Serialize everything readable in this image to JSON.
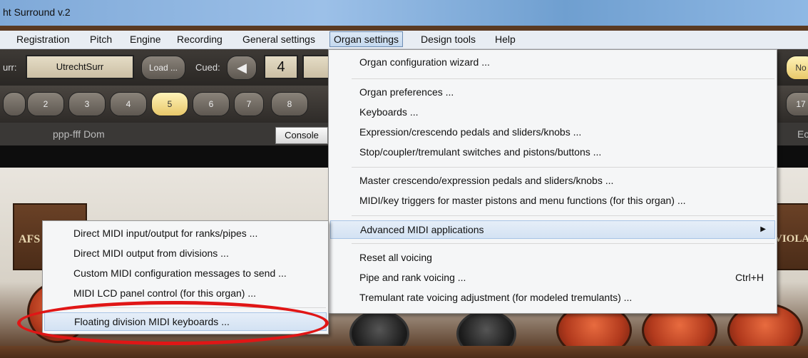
{
  "window": {
    "title": "ht Surround v.2"
  },
  "menubar": {
    "items": [
      "Registration",
      "Pitch",
      "Engine",
      "Recording",
      "General settings",
      "Organ settings",
      "Design tools",
      "Help"
    ],
    "active": "Organ settings"
  },
  "toolbar": {
    "surr_label": "urr:",
    "surr_value": "UtrechtSurr",
    "load_button": "Load ...",
    "cued_label": "Cued:",
    "cued_value": "4",
    "right_pill": "No",
    "piston_numbers": [
      "2",
      "3",
      "4",
      "5",
      "6",
      "7",
      "8"
    ],
    "piston_lit": "5",
    "right_piston": "17",
    "division_label": "ppp-fff Dom",
    "console_button": "Console",
    "right_edge_label": "Ec"
  },
  "organ": {
    "left_plaque": "AFS",
    "right_plaque": "VIOLA"
  },
  "organ_menu": {
    "items": [
      {
        "label": "Organ configuration wizard ..."
      },
      {
        "sep": true
      },
      {
        "label": "Organ preferences ..."
      },
      {
        "label": "Keyboards ..."
      },
      {
        "label": "Expression/crescendo pedals and sliders/knobs ..."
      },
      {
        "label": "Stop/coupler/tremulant switches and pistons/buttons ..."
      },
      {
        "sep": true
      },
      {
        "label": "Master crescendo/expression pedals and sliders/knobs ..."
      },
      {
        "label": "MIDI/key triggers for master pistons and menu functions (for this organ) ..."
      },
      {
        "sep": true
      },
      {
        "label": "Advanced MIDI applications",
        "submenu": true
      },
      {
        "sep": true
      },
      {
        "label": "Reset all voicing"
      },
      {
        "label": "Pipe and rank voicing ...",
        "shortcut": "Ctrl+H"
      },
      {
        "label": "Tremulant rate voicing adjustment (for modeled tremulants) ..."
      }
    ]
  },
  "advanced_submenu": {
    "items": [
      "Direct MIDI input/output for ranks/pipes ...",
      "Direct MIDI output from divisions ...",
      "Custom MIDI configuration messages to send ...",
      "MIDI LCD panel control (for this organ) ...",
      "Floating division MIDI keyboards ..."
    ],
    "highlighted": "Floating division MIDI keyboards ..."
  }
}
